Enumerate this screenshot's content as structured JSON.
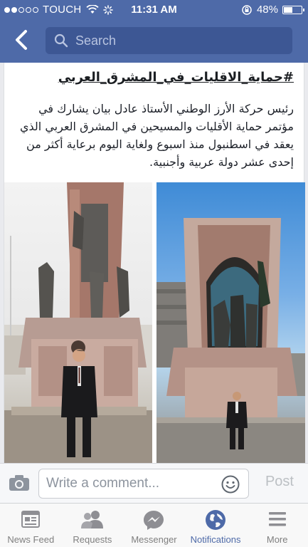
{
  "status_bar": {
    "carrier": "TOUCH",
    "time": "11:31 AM",
    "battery": "48%",
    "battery_level": 0.48
  },
  "search": {
    "placeholder": "Search"
  },
  "post": {
    "hashtag": "#حماية_الاقليات_في_المشرق_العربي",
    "text": "رئيس حركة الأرز الوطني الأستاذ عادل بيان يشارك في مؤتمر حماية الأقليات والمسيحين في المشرق العربي الذي يعقد في اسطنبول منذ اسبوع ولغاية اليوم برعاية أكثر من إحدى عشر دولة عربية وأجنبية."
  },
  "comment": {
    "placeholder": "Write a comment...",
    "post_label": "Post"
  },
  "tabs": [
    {
      "label": "News Feed",
      "icon": "news-feed-icon",
      "active": false
    },
    {
      "label": "Requests",
      "icon": "requests-icon",
      "active": false
    },
    {
      "label": "Messenger",
      "icon": "messenger-icon",
      "active": false
    },
    {
      "label": "Notifications",
      "icon": "notifications-icon",
      "active": true
    },
    {
      "label": "More",
      "icon": "more-icon",
      "active": false
    }
  ],
  "colors": {
    "brand": "#4e6aa8",
    "search_bg": "#3d5794",
    "inactive_tab": "#7f7f7f"
  }
}
